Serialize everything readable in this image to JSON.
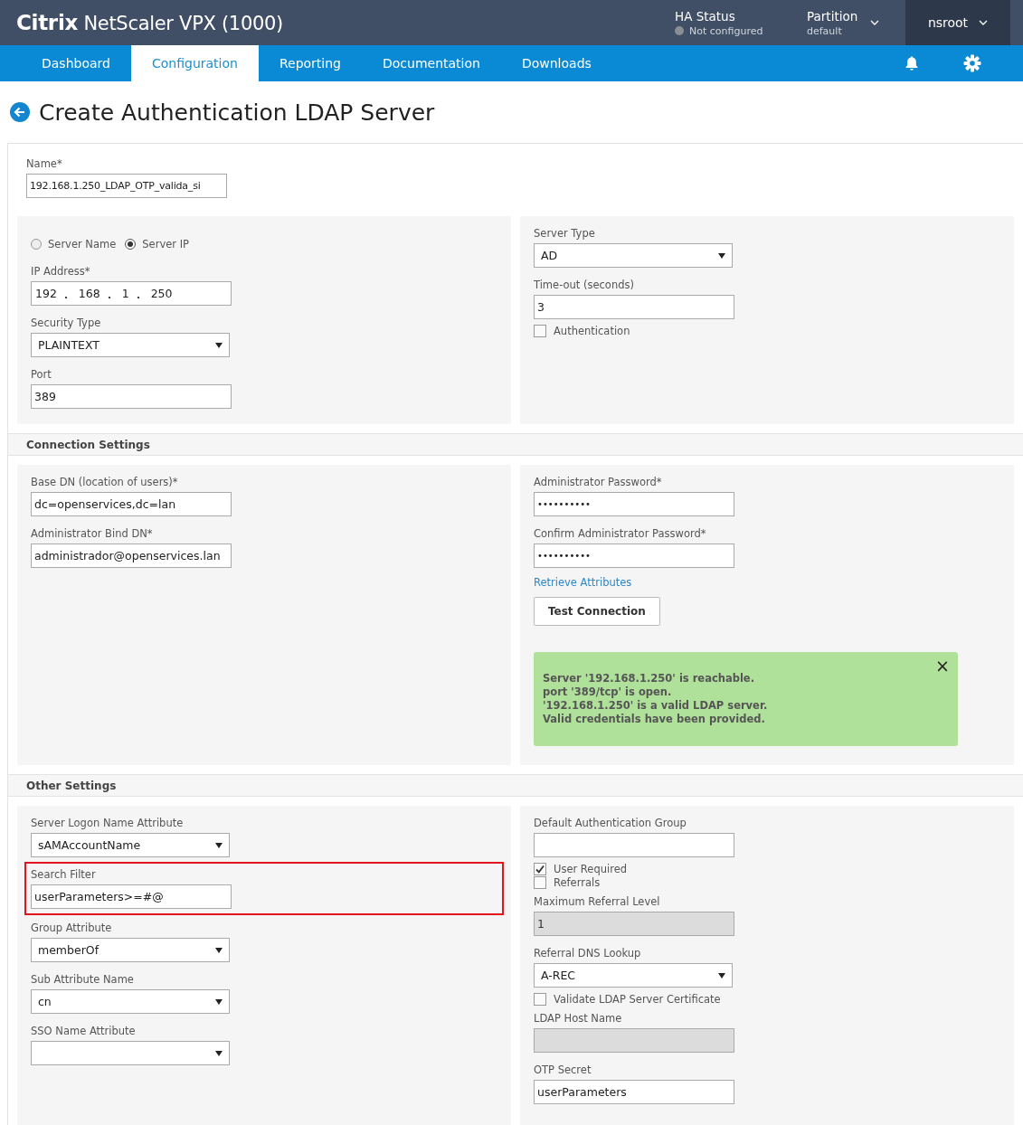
{
  "header": {
    "brand_bold": "Citrix",
    "brand_rest": "NetScaler VPX (1000)",
    "ha_status": {
      "label": "HA Status",
      "value": "Not configured"
    },
    "partition": {
      "label": "Partition",
      "value": "default"
    },
    "user": "nsroot"
  },
  "nav": {
    "tabs": [
      {
        "label": "Dashboard",
        "selected": false
      },
      {
        "label": "Configuration",
        "selected": true
      },
      {
        "label": "Reporting",
        "selected": false
      },
      {
        "label": "Documentation",
        "selected": false
      },
      {
        "label": "Downloads",
        "selected": false
      }
    ]
  },
  "page_title": "Create Authentication LDAP Server",
  "name_field": {
    "label": "Name*",
    "value": "192.168.1.250_LDAP_OTP_valida_si"
  },
  "sections": [
    {
      "left": [
        {
          "kind": "radio",
          "options": [
            {
              "label": "Server Name",
              "selected": false
            },
            {
              "label": "Server IP",
              "selected": true
            }
          ]
        },
        {
          "kind": "ip",
          "label": "IP Address*",
          "octets": [
            "192",
            "168",
            "1",
            "250"
          ]
        },
        {
          "kind": "select",
          "label": "Security Type",
          "value": "PLAINTEXT"
        },
        {
          "kind": "text",
          "label": "Port",
          "value": "389"
        }
      ],
      "right": [
        {
          "kind": "select",
          "label": "Server Type",
          "value": "AD"
        },
        {
          "kind": "text",
          "label": "Time-out (seconds)",
          "value": "3"
        },
        {
          "kind": "checkbox",
          "label": "Authentication",
          "checked": false
        }
      ]
    },
    {
      "title": "Connection Settings",
      "left": [
        {
          "kind": "text",
          "label": "Base DN (location of users)*",
          "value": "dc=openservices,dc=lan"
        },
        {
          "kind": "text",
          "label": "Administrator Bind DN*",
          "value": "administrador@openservices.lan"
        }
      ],
      "right": [
        {
          "kind": "password",
          "label": "Administrator Password*",
          "value": "••••••••••"
        },
        {
          "kind": "password",
          "label": "Confirm Administrator Password*",
          "value": "••••••••••"
        },
        {
          "kind": "link",
          "label": "Retrieve Attributes"
        },
        {
          "kind": "button",
          "label": "Test Connection"
        },
        {
          "kind": "alert",
          "close": "×",
          "lines": [
            "Server '192.168.1.250' is reachable.",
            "port '389/tcp' is open.",
            "'192.168.1.250' is a valid LDAP server.",
            "Valid credentials have been provided."
          ]
        }
      ]
    },
    {
      "title": "Other Settings",
      "left": [
        {
          "kind": "select",
          "label": "Server Logon Name Attribute",
          "value": "sAMAccountName"
        },
        {
          "kind": "text",
          "label": "Search Filter",
          "value": "userParameters>=#@",
          "highlighted": true
        },
        {
          "kind": "select",
          "label": "Group Attribute",
          "value": "memberOf"
        },
        {
          "kind": "select",
          "label": "Sub Attribute Name",
          "value": "cn"
        },
        {
          "kind": "select",
          "label": "SSO Name Attribute"
        }
      ],
      "right": [
        {
          "kind": "text",
          "label": "Default Authentication Group"
        },
        {
          "kind": "checkbox",
          "label": "User Required",
          "checked": true
        },
        {
          "kind": "checkbox",
          "label": "Referrals",
          "checked": false
        },
        {
          "kind": "text",
          "label": "Maximum Referral Level",
          "value": "1",
          "disabled": true
        },
        {
          "kind": "select",
          "label": "Referral DNS Lookup",
          "value": "A-REC"
        },
        {
          "kind": "checkbox",
          "label": "Validate LDAP Server Certificate",
          "checked": false
        },
        {
          "kind": "text",
          "label": "LDAP Host Name",
          "disabled": true
        },
        {
          "kind": "text",
          "label": "OTP Secret",
          "value": "userParameters"
        }
      ]
    }
  ]
}
